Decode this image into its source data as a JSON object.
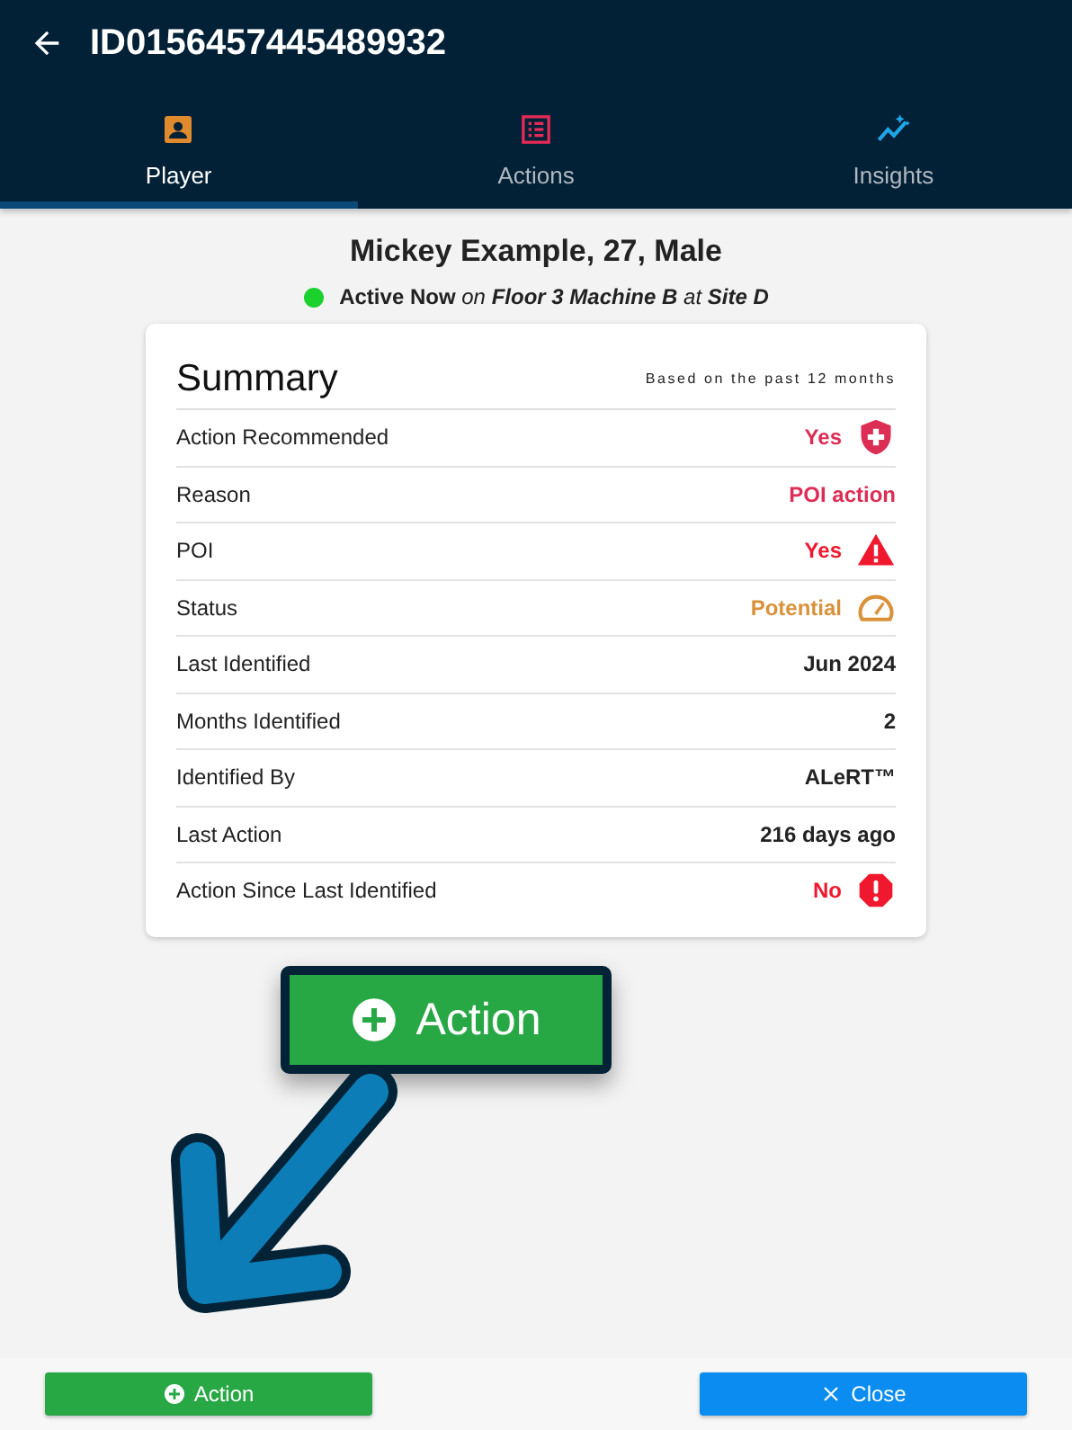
{
  "header": {
    "title": "ID0156457445489932"
  },
  "tabs": [
    {
      "label": "Player",
      "kind": "person",
      "selected": true
    },
    {
      "label": "Actions",
      "kind": "list",
      "selected": false
    },
    {
      "label": "Insights",
      "kind": "trend",
      "selected": false
    }
  ],
  "player": {
    "name": "Mickey Example, 27, Male",
    "online": true,
    "presence": "**Active Now** *on* **Floor 3 Machine B** *at* **Site D**"
  },
  "summary": {
    "title": "Summary",
    "note": "Based on the past 12 months",
    "rows": [
      {
        "label": "Action Recommended",
        "value": "Yes",
        "color": "#dc2d55",
        "kind": "shield"
      },
      {
        "label": "Reason",
        "value": "POI action",
        "color": "#dc2d55",
        "kind": "none"
      },
      {
        "label": "POI",
        "value": "Yes",
        "color": "#f0182e",
        "kind": "warning"
      },
      {
        "label": "Status",
        "value": "Potential",
        "color": "#d9923a",
        "kind": "gauge"
      },
      {
        "label": "Last Identified",
        "value": "Jun 2024",
        "color": "#222222",
        "kind": "none"
      },
      {
        "label": "Months Identified",
        "value": "2",
        "color": "#222222",
        "kind": "none"
      },
      {
        "label": "Identified By",
        "value": "ALeRT™",
        "color": "#222222",
        "kind": "none"
      },
      {
        "label": "Last Action",
        "value": "216 days ago",
        "color": "#222222",
        "kind": "none"
      },
      {
        "label": "Action Since Last Identified",
        "value": "No",
        "color": "#f0182e",
        "kind": "octagon"
      }
    ]
  },
  "callout": {
    "label": "Action"
  },
  "buttons": [
    {
      "label": "Action",
      "kind": "add"
    },
    {
      "label": "Close",
      "kind": "close"
    }
  ]
}
